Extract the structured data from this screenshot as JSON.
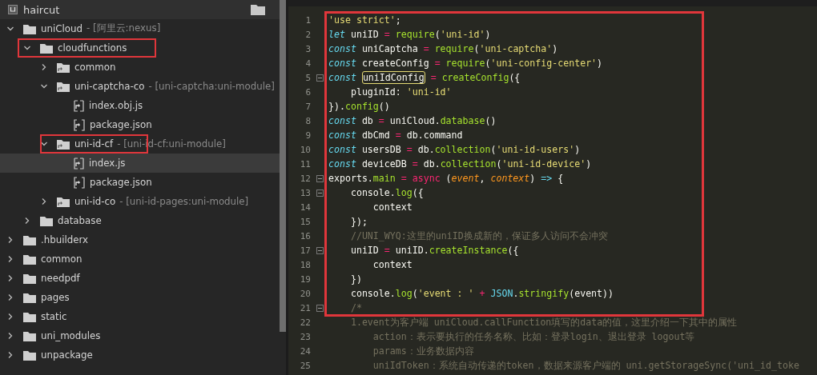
{
  "project": {
    "name": "haircut"
  },
  "tree": [
    {
      "label": "uniCloud",
      "tag": "- [阿里云:nexus]",
      "kind": "folder",
      "expanded": true,
      "selected": false,
      "annotated": false,
      "children": [
        {
          "label": "cloudfunctions",
          "kind": "folder",
          "expanded": true,
          "selected": false,
          "annotated": true,
          "children": [
            {
              "label": "common",
              "kind": "module",
              "expanded": false,
              "selected": false,
              "annotated": false
            },
            {
              "label": "uni-captcha-co",
              "tag": "- [uni-captcha:uni-module]",
              "kind": "module",
              "expanded": true,
              "selected": false,
              "annotated": false,
              "children": [
                {
                  "label": "index.obj.js",
                  "kind": "js",
                  "selected": false,
                  "annotated": false
                },
                {
                  "label": "package.json",
                  "kind": "json",
                  "selected": false,
                  "annotated": false
                }
              ]
            },
            {
              "label": "uni-id-cf",
              "tag": "- [uni-id-cf:uni-module]",
              "kind": "module",
              "expanded": true,
              "selected": false,
              "annotated": true,
              "children": [
                {
                  "label": "index.js",
                  "kind": "js",
                  "selected": true,
                  "annotated": false
                },
                {
                  "label": "package.json",
                  "kind": "json",
                  "selected": false,
                  "annotated": false
                }
              ]
            },
            {
              "label": "uni-id-co",
              "tag": "- [uni-id-pages:uni-module]",
              "kind": "module",
              "expanded": false,
              "selected": false,
              "annotated": false
            }
          ]
        },
        {
          "label": "database",
          "kind": "folder",
          "expanded": false,
          "selected": false,
          "annotated": false
        }
      ]
    },
    {
      "label": ".hbuilderx",
      "kind": "folder",
      "expanded": false,
      "selected": false,
      "annotated": false
    },
    {
      "label": "common",
      "kind": "folder",
      "expanded": false,
      "selected": false,
      "annotated": false
    },
    {
      "label": "needpdf",
      "kind": "folder",
      "expanded": false,
      "selected": false,
      "annotated": false
    },
    {
      "label": "pages",
      "kind": "folder",
      "expanded": false,
      "selected": false,
      "annotated": false
    },
    {
      "label": "static",
      "kind": "folder",
      "expanded": false,
      "selected": false,
      "annotated": false
    },
    {
      "label": "uni_modules",
      "kind": "folder",
      "expanded": false,
      "selected": false,
      "annotated": false
    },
    {
      "label": "unpackage",
      "kind": "folder",
      "expanded": false,
      "selected": false,
      "annotated": false
    }
  ],
  "editor": {
    "annotated": true,
    "lines": [
      {
        "number": "1",
        "fold": false,
        "tokens": [
          {
            "kind": "str",
            "text": "'use strict'"
          },
          {
            "kind": "plain",
            "text": ";"
          }
        ]
      },
      {
        "number": "2",
        "fold": false,
        "tokens": [
          {
            "kind": "kw",
            "text": "let"
          },
          {
            "kind": "plain",
            "text": " uniID "
          },
          {
            "kind": "op",
            "text": "= "
          },
          {
            "kind": "fn",
            "text": "require"
          },
          {
            "kind": "plain",
            "text": "("
          },
          {
            "kind": "str",
            "text": "'uni-id'"
          },
          {
            "kind": "plain",
            "text": ")"
          }
        ]
      },
      {
        "number": "3",
        "fold": false,
        "tokens": [
          {
            "kind": "kw",
            "text": "const"
          },
          {
            "kind": "plain",
            "text": " uniCaptcha "
          },
          {
            "kind": "op",
            "text": "= "
          },
          {
            "kind": "fn",
            "text": "require"
          },
          {
            "kind": "plain",
            "text": "("
          },
          {
            "kind": "str",
            "text": "'uni-captcha'"
          },
          {
            "kind": "plain",
            "text": ")"
          }
        ]
      },
      {
        "number": "4",
        "fold": false,
        "tokens": [
          {
            "kind": "kw",
            "text": "const"
          },
          {
            "kind": "plain",
            "text": " createConfig "
          },
          {
            "kind": "op",
            "text": "= "
          },
          {
            "kind": "fn",
            "text": "require"
          },
          {
            "kind": "plain",
            "text": "("
          },
          {
            "kind": "str",
            "text": "'uni-config-center'"
          },
          {
            "kind": "plain",
            "text": ")"
          }
        ]
      },
      {
        "number": "5",
        "fold": true,
        "tokens": [
          {
            "kind": "kw",
            "text": "const "
          },
          {
            "kind": "match",
            "text": "uniIdConfig"
          },
          {
            "kind": "op",
            "text": " = "
          },
          {
            "kind": "fn",
            "text": "createConfig"
          },
          {
            "kind": "plain",
            "text": "({"
          }
        ]
      },
      {
        "number": "6",
        "fold": false,
        "tokens": [
          {
            "kind": "plain",
            "text": "    pluginId: "
          },
          {
            "kind": "str",
            "text": "'uni-id'"
          }
        ]
      },
      {
        "number": "7",
        "fold": false,
        "tokens": [
          {
            "kind": "plain",
            "text": "})."
          },
          {
            "kind": "fn",
            "text": "config"
          },
          {
            "kind": "plain",
            "text": "()"
          }
        ]
      },
      {
        "number": "8",
        "fold": false,
        "tokens": [
          {
            "kind": "kw",
            "text": "const"
          },
          {
            "kind": "plain",
            "text": " db "
          },
          {
            "kind": "op",
            "text": "="
          },
          {
            "kind": "plain",
            "text": " uniCloud."
          },
          {
            "kind": "fn",
            "text": "database"
          },
          {
            "kind": "plain",
            "text": "()"
          }
        ]
      },
      {
        "number": "9",
        "fold": false,
        "tokens": [
          {
            "kind": "kw",
            "text": "const"
          },
          {
            "kind": "plain",
            "text": " dbCmd "
          },
          {
            "kind": "op",
            "text": "="
          },
          {
            "kind": "plain",
            "text": " db.command"
          }
        ]
      },
      {
        "number": "10",
        "fold": false,
        "tokens": [
          {
            "kind": "kw",
            "text": "const"
          },
          {
            "kind": "plain",
            "text": " usersDB "
          },
          {
            "kind": "op",
            "text": "="
          },
          {
            "kind": "plain",
            "text": " db."
          },
          {
            "kind": "fn",
            "text": "collection"
          },
          {
            "kind": "plain",
            "text": "("
          },
          {
            "kind": "str",
            "text": "'uni-id-users'"
          },
          {
            "kind": "plain",
            "text": ")"
          }
        ]
      },
      {
        "number": "11",
        "fold": false,
        "tokens": [
          {
            "kind": "kw",
            "text": "const"
          },
          {
            "kind": "plain",
            "text": " deviceDB "
          },
          {
            "kind": "op",
            "text": "="
          },
          {
            "kind": "plain",
            "text": " db."
          },
          {
            "kind": "fn",
            "text": "collection"
          },
          {
            "kind": "plain",
            "text": "("
          },
          {
            "kind": "str",
            "text": "'uni-id-device'"
          },
          {
            "kind": "plain",
            "text": ")"
          }
        ]
      },
      {
        "number": "12",
        "fold": true,
        "tokens": [
          {
            "kind": "plain",
            "text": "exports."
          },
          {
            "kind": "fn",
            "text": "main"
          },
          {
            "kind": "op",
            "text": " = async"
          },
          {
            "kind": "plain",
            "text": " ("
          },
          {
            "kind": "param",
            "text": "event"
          },
          {
            "kind": "plain",
            "text": ", "
          },
          {
            "kind": "param",
            "text": "context"
          },
          {
            "kind": "plain",
            "text": ") "
          },
          {
            "kind": "builtin",
            "text": "=>"
          },
          {
            "kind": "plain",
            "text": " {"
          }
        ]
      },
      {
        "number": "13",
        "fold": true,
        "tokens": [
          {
            "kind": "plain",
            "text": "    console."
          },
          {
            "kind": "fn",
            "text": "log"
          },
          {
            "kind": "plain",
            "text": "({"
          }
        ]
      },
      {
        "number": "14",
        "fold": false,
        "tokens": [
          {
            "kind": "plain",
            "text": "        context"
          }
        ]
      },
      {
        "number": "15",
        "fold": false,
        "tokens": [
          {
            "kind": "plain",
            "text": "    });"
          }
        ]
      },
      {
        "number": "16",
        "fold": false,
        "tokens": [
          {
            "kind": "comment",
            "text": "    //UNI_WYQ:这里的uniID换成新的，保证多人访问不会冲突"
          }
        ]
      },
      {
        "number": "17",
        "fold": true,
        "tokens": [
          {
            "kind": "plain",
            "text": "    uniID "
          },
          {
            "kind": "op",
            "text": "="
          },
          {
            "kind": "plain",
            "text": " uniID."
          },
          {
            "kind": "fn",
            "text": "createInstance"
          },
          {
            "kind": "plain",
            "text": "({"
          }
        ]
      },
      {
        "number": "18",
        "fold": false,
        "tokens": [
          {
            "kind": "plain",
            "text": "        context"
          }
        ]
      },
      {
        "number": "19",
        "fold": false,
        "tokens": [
          {
            "kind": "plain",
            "text": "    })"
          }
        ]
      },
      {
        "number": "20",
        "fold": false,
        "tokens": [
          {
            "kind": "plain",
            "text": "    console."
          },
          {
            "kind": "fn",
            "text": "log"
          },
          {
            "kind": "plain",
            "text": "("
          },
          {
            "kind": "str",
            "text": "'event : '"
          },
          {
            "kind": "op",
            "text": " + "
          },
          {
            "kind": "builtin",
            "text": "JSON"
          },
          {
            "kind": "plain",
            "text": "."
          },
          {
            "kind": "fn",
            "text": "stringify"
          },
          {
            "kind": "plain",
            "text": "(event))"
          }
        ]
      },
      {
        "number": "21",
        "fold": true,
        "tokens": [
          {
            "kind": "comment",
            "text": "    /*"
          }
        ]
      },
      {
        "number": "22",
        "fold": false,
        "tokens": [
          {
            "kind": "comment",
            "text": "    1.event为客户端 uniCloud.callFunction填写的data的值，这里介绍一下其中的属性"
          }
        ]
      },
      {
        "number": "23",
        "fold": false,
        "tokens": [
          {
            "kind": "comment",
            "text": "        action：表示要执行的任务名称、比如：登录login、退出登录 logout等"
          }
        ]
      },
      {
        "number": "24",
        "fold": false,
        "tokens": [
          {
            "kind": "comment",
            "text": "        params：业务数据内容"
          }
        ]
      },
      {
        "number": "25",
        "fold": false,
        "tokens": [
          {
            "kind": "comment",
            "text": "        uniIdToken：系统自动传递的token，数据来源客户端的 uni.getStorageSync('uni_id_toke"
          }
        ]
      }
    ]
  }
}
